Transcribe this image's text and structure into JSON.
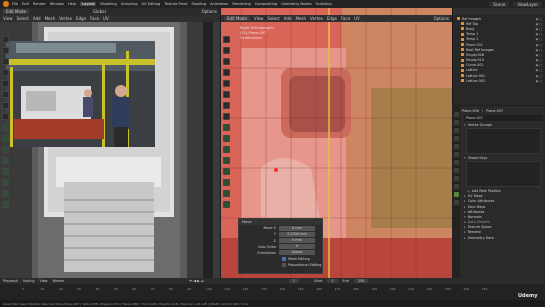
{
  "topbar": {
    "menus": [
      "File",
      "Edit",
      "Render",
      "Window",
      "Help"
    ],
    "workspaces": [
      "Layout",
      "Modeling",
      "Sculpting",
      "UV Editing",
      "Texture Paint",
      "Shading",
      "Animation",
      "Rendering",
      "Compositing",
      "Geometry Nodes",
      "Scripting"
    ],
    "active_workspace": "Layout",
    "scene": "Scene",
    "view_layer": "ViewLayer"
  },
  "left_viewport": {
    "mode": "Edit Mode",
    "menus": [
      "View",
      "Select",
      "Add",
      "Mesh",
      "Vertex",
      "Edge",
      "Face",
      "UV"
    ],
    "transform_orientation": "Global",
    "options": "Options"
  },
  "right_viewport": {
    "mode": "Edit Mode",
    "menus": [
      "View",
      "Select",
      "Add",
      "Mesh",
      "Vertex",
      "Edge",
      "Face",
      "UV"
    ],
    "transform_orientation": "Global",
    "options": "Options",
    "info": [
      "Right Orthographic",
      "(11) Plane.007",
      "Centimeters"
    ]
  },
  "move_panel": {
    "title": "Move",
    "fields": [
      {
        "label": "Move X",
        "value": "0 mm"
      },
      {
        "label": "Y",
        "value": "0.2334 mm"
      },
      {
        "label": "Z",
        "value": "0 mm"
      }
    ],
    "axis_ortho_label": "Axis Ortho",
    "axis_ortho_value": "X",
    "orientation_label": "Orientation",
    "orientation_value": "Global",
    "checks": [
      {
        "label": "Mesh Editing",
        "checked": true
      },
      {
        "label": "Proportional Editing",
        "checked": false
      }
    ]
  },
  "outliner": {
    "items": [
      {
        "name": "Ref images",
        "visibility": "◉ ▢"
      },
      {
        "name": "Ref Top",
        "visibility": "◉ ▢"
      },
      {
        "name": "Body",
        "visibility": "◉ ▢"
      },
      {
        "name": "Temp 1",
        "visibility": "◉ ▢"
      },
      {
        "name": "Temp 2",
        "visibility": "◉ ▢"
      },
      {
        "name": "Plane 001",
        "visibility": "◉ ▢"
      },
      {
        "name": "Roof Ref Images",
        "visibility": "◉ ▢"
      },
      {
        "name": "Empty.008",
        "visibility": "◉ ▢"
      },
      {
        "name": "Empty.010",
        "visibility": "◉ ▢"
      },
      {
        "name": "Curve.002",
        "visibility": "◉ ▢"
      },
      {
        "name": "Lattice",
        "visibility": "◉ ▢"
      },
      {
        "name": "Lattice.001",
        "visibility": "◉ ▢"
      },
      {
        "name": "Lattice.002",
        "visibility": "◉ ▢"
      }
    ]
  },
  "properties": {
    "object_path": [
      "Plane.006",
      "Plane.007"
    ],
    "data_name": "Plane.007",
    "sections": [
      {
        "label": "Vertex Groups",
        "open": true,
        "dim": false
      },
      {
        "label": "Shape Keys",
        "open": true,
        "dim": false
      },
      {
        "label": "UV Maps",
        "open": false,
        "dim": false
      },
      {
        "label": "Color Attributes",
        "open": false,
        "dim": false
      },
      {
        "label": "Face Maps",
        "open": false,
        "dim": false
      },
      {
        "label": "Attributes",
        "open": false,
        "dim": false
      },
      {
        "label": "Normals",
        "open": true,
        "dim": false
      },
      {
        "label": "Auto Smooth",
        "open": false,
        "dim": true
      },
      {
        "label": "Texture Space",
        "open": false,
        "dim": false
      },
      {
        "label": "Remesh",
        "open": false,
        "dim": false
      },
      {
        "label": "Geometry Data",
        "open": false,
        "dim": false
      }
    ],
    "add_rest_position": "Add Rest Position"
  },
  "timeline": {
    "menus": [
      "Playback",
      "Keying",
      "View",
      "Marker"
    ],
    "ticks": [
      "0",
      "10",
      "20",
      "30",
      "40",
      "50",
      "60",
      "70",
      "80",
      "90",
      "100",
      "110",
      "120",
      "130",
      "140",
      "150",
      "160",
      "170",
      "180",
      "190",
      "200",
      "210",
      "220",
      "230",
      "240",
      "250"
    ],
    "frame": "1",
    "start_label": "Start",
    "start": "1",
    "end_label": "End",
    "end": "250"
  },
  "statusbar": {
    "text": "Select   Box Select   Rotate View   Call Menu   Plane.007 | Verts 4/88 | Edges 2/174 | Faces 0/86 | Tris 4,546 | Objects 1/18 | Memory 1.04 GiB | VRAM 1.4/24.0 GiB | 3.3.1"
  },
  "watermark": "Udemy"
}
